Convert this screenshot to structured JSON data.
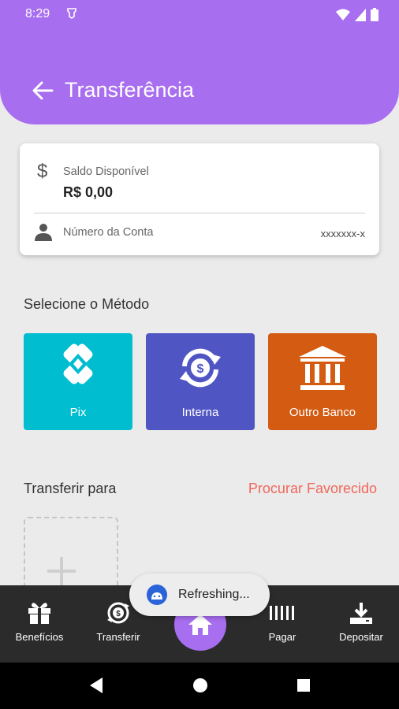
{
  "status_bar": {
    "time": "8:29"
  },
  "header": {
    "title": "Transferência"
  },
  "account_card": {
    "saldo_label": "Saldo Disponível",
    "saldo_value": "R$ 0,00",
    "conta_label": "Número da Conta",
    "conta_value": "xxxxxxx-x"
  },
  "method_section": {
    "label": "Selecione o Método",
    "methods": [
      {
        "label": "Pix",
        "color": "#00bdd0",
        "icon": "pix-icon"
      },
      {
        "label": "Interna",
        "color": "#4f55c3",
        "icon": "exchange-icon"
      },
      {
        "label": "Outro Banco",
        "color": "#d35b12",
        "icon": "bank-icon"
      }
    ]
  },
  "transfer_section": {
    "label": "Transferir para",
    "search_link": "Procurar Favorecido"
  },
  "bottom_nav": {
    "items": [
      {
        "label": "Benefícios",
        "icon": "gift-icon"
      },
      {
        "label": "Transferir",
        "icon": "transfer-icon"
      },
      {
        "label": "Pagar",
        "icon": "barcode-icon"
      },
      {
        "label": "Depositar",
        "icon": "download-icon"
      }
    ]
  },
  "toast": {
    "text": "Refreshing..."
  },
  "colors": {
    "accent": "#a86ef0",
    "link": "#f0685c"
  }
}
